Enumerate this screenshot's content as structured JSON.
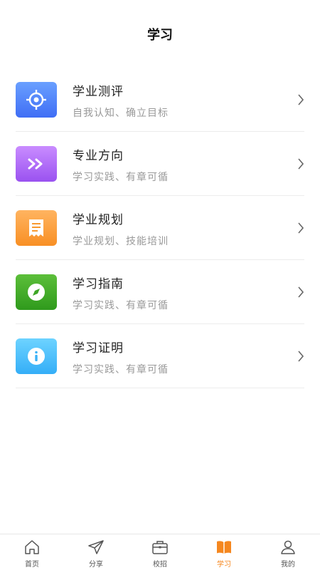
{
  "header": {
    "title": "学习"
  },
  "items": [
    {
      "title": "学业测评",
      "subtitle": "自我认知、确立目标",
      "icon": "target-icon",
      "color_top": "#6aa0ff",
      "color_bottom": "#3f6ef5"
    },
    {
      "title": "专业方向",
      "subtitle": "学习实践、有章可循",
      "icon": "double-chevron-icon",
      "color_top": "#c98cff",
      "color_bottom": "#9a52f0"
    },
    {
      "title": "学业规划",
      "subtitle": "学业规划、技能培训",
      "icon": "receipt-icon",
      "color_top": "#ffb460",
      "color_bottom": "#f88f24"
    },
    {
      "title": "学习指南",
      "subtitle": "学习实践、有章可循",
      "icon": "compass-icon",
      "color_top": "#5cbf3a",
      "color_bottom": "#2f9a1c"
    },
    {
      "title": "学习证明",
      "subtitle": "学习实践、有章可循",
      "icon": "info-icon",
      "color_top": "#6dd3ff",
      "color_bottom": "#34aef7"
    }
  ],
  "tabbar": {
    "tabs": [
      {
        "label": "首页",
        "icon": "home-icon"
      },
      {
        "label": "分享",
        "icon": "send-icon"
      },
      {
        "label": "校招",
        "icon": "briefcase-icon"
      },
      {
        "label": "学习",
        "icon": "book-icon",
        "active": true
      },
      {
        "label": "我的",
        "icon": "user-icon"
      }
    ],
    "active_color": "#f5871f"
  }
}
